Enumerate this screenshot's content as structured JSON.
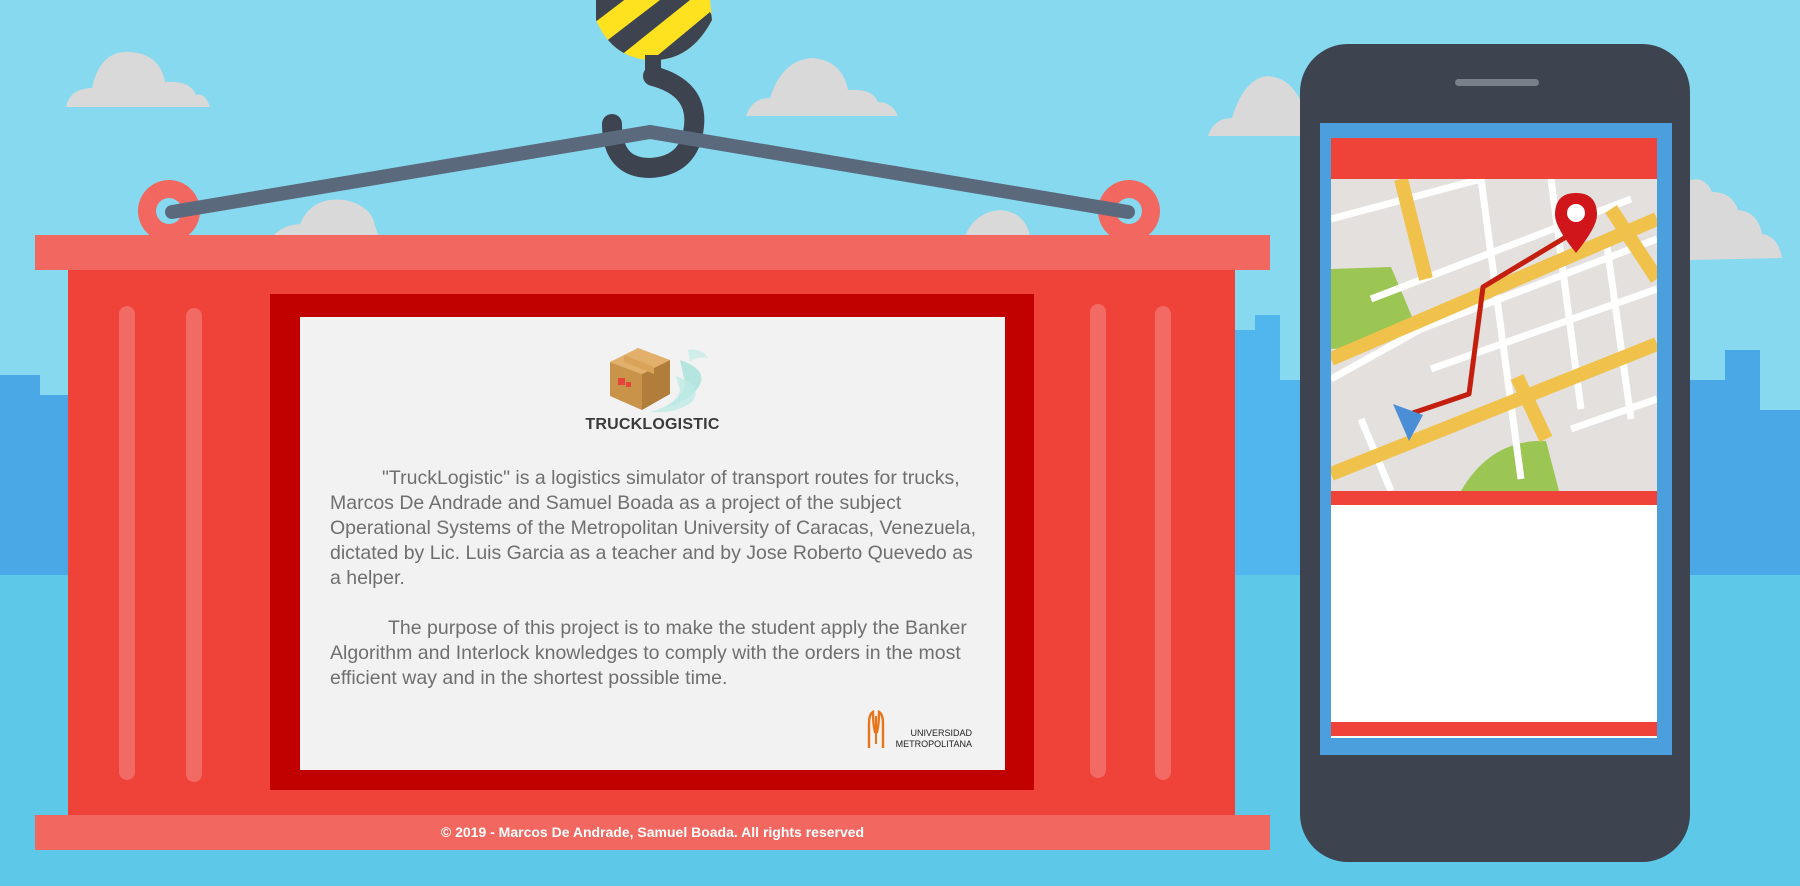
{
  "brand": {
    "name": "TRUCKLOGISTIC",
    "logo_icon": "flying-box-icon"
  },
  "description": {
    "paragraph_1": "\"TruckLogistic\" is a logistics simulator of transport routes for trucks, Marcos De Andrade and Samuel Boada as a project of the subject Operational Systems of the Metropolitan University of Caracas, Venezuela, dictated by Lic. Luis Garcia as a teacher and by Jose Roberto Quevedo as a helper.",
    "paragraph_2": "The purpose of this project is to make the student apply the Banker Algorithm and Interlock knowledges to comply with the orders in the most efficient way and in the shortest possible time."
  },
  "university": {
    "line_1": "UNIVERSIDAD",
    "line_2": "METROPOLITANA",
    "logo_icon": "university-emblem-icon"
  },
  "footer": {
    "copyright": "© 2019 - Marcos De Andrade, Samuel Boada. All rights reserved"
  },
  "phone": {
    "map_icon": "map-icon",
    "pin_icon": "location-pin-icon",
    "navigation_icon": "navigation-arrow-icon"
  },
  "colors": {
    "sky": "#86d9ef",
    "container_red": "#ef4339",
    "panel_frame": "#c10000",
    "phone_body": "#3d4450",
    "screen_border": "#4c9fdd"
  }
}
